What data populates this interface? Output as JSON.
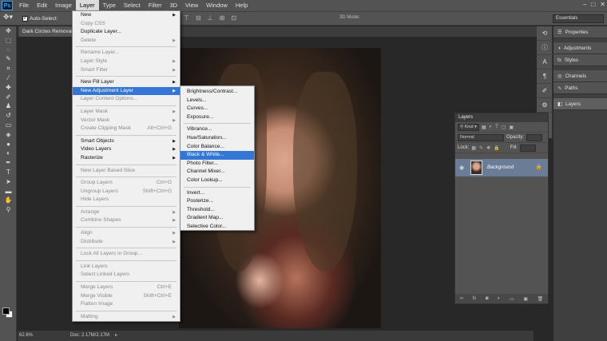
{
  "menubar": {
    "logo": "Ps",
    "items": [
      "File",
      "Edit",
      "Image",
      "Layer",
      "Type",
      "Select",
      "Filter",
      "3D",
      "View",
      "Window",
      "Help"
    ],
    "window_controls": [
      "–",
      "□",
      "✕"
    ]
  },
  "options_bar": {
    "auto_select_label": "Auto-Select:",
    "mode_3d_label": "3D Mode:",
    "workspace": "Essentials"
  },
  "document": {
    "tab_title": "Dark Circles Removal...",
    "zoom": "62.6%",
    "doc_size": "Doc: 2.17M/2.17M"
  },
  "layer_menu": {
    "items": [
      {
        "label": "New",
        "arrow": true,
        "disabled": false
      },
      {
        "label": "Copy CSS",
        "disabled": true
      },
      {
        "label": "Duplicate Layer...",
        "disabled": false
      },
      {
        "label": "Delete",
        "arrow": true,
        "disabled": true
      },
      {
        "sep": true
      },
      {
        "label": "Rename Layer...",
        "disabled": true
      },
      {
        "label": "Layer Style",
        "arrow": true,
        "disabled": true
      },
      {
        "label": "Smart Filter",
        "arrow": true,
        "disabled": true
      },
      {
        "sep": true
      },
      {
        "label": "New Fill Layer",
        "arrow": true,
        "disabled": false
      },
      {
        "label": "New Adjustment Layer",
        "arrow": true,
        "disabled": false,
        "highlight": true
      },
      {
        "label": "Layer Content Options...",
        "disabled": true
      },
      {
        "sep": true
      },
      {
        "label": "Layer Mask",
        "arrow": true,
        "disabled": true
      },
      {
        "label": "Vector Mask",
        "arrow": true,
        "disabled": true
      },
      {
        "label": "Create Clipping Mask",
        "shortcut": "Alt+Ctrl+G",
        "disabled": true
      },
      {
        "sep": true
      },
      {
        "label": "Smart Objects",
        "arrow": true,
        "disabled": false
      },
      {
        "label": "Video Layers",
        "arrow": true,
        "disabled": false
      },
      {
        "label": "Rasterize",
        "arrow": true,
        "disabled": false
      },
      {
        "sep": true
      },
      {
        "label": "New Layer Based Slice",
        "disabled": true
      },
      {
        "sep": true
      },
      {
        "label": "Group Layers",
        "shortcut": "Ctrl+G",
        "disabled": true
      },
      {
        "label": "Ungroup Layers",
        "shortcut": "Shift+Ctrl+G",
        "disabled": true
      },
      {
        "label": "Hide Layers",
        "disabled": true
      },
      {
        "sep": true
      },
      {
        "label": "Arrange",
        "arrow": true,
        "disabled": true
      },
      {
        "label": "Combine Shapes",
        "arrow": true,
        "disabled": true
      },
      {
        "sep": true
      },
      {
        "label": "Align",
        "arrow": true,
        "disabled": true
      },
      {
        "label": "Distribute",
        "arrow": true,
        "disabled": true
      },
      {
        "sep": true
      },
      {
        "label": "Lock All Layers in Group...",
        "disabled": true
      },
      {
        "sep": true
      },
      {
        "label": "Link Layers",
        "disabled": true
      },
      {
        "label": "Select Linked Layers",
        "disabled": true
      },
      {
        "sep": true
      },
      {
        "label": "Merge Layers",
        "shortcut": "Ctrl+E",
        "disabled": true
      },
      {
        "label": "Merge Visible",
        "shortcut": "Shift+Ctrl+E",
        "disabled": true
      },
      {
        "label": "Flatten Image",
        "disabled": true
      },
      {
        "sep": true
      },
      {
        "label": "Matting",
        "arrow": true,
        "disabled": true
      }
    ]
  },
  "adjustment_menu": {
    "items": [
      {
        "label": "Brightness/Contrast..."
      },
      {
        "label": "Levels..."
      },
      {
        "label": "Curves..."
      },
      {
        "label": "Exposure..."
      },
      {
        "sep": true
      },
      {
        "label": "Vibrance..."
      },
      {
        "label": "Hue/Saturation..."
      },
      {
        "label": "Color Balance..."
      },
      {
        "label": "Black & White...",
        "highlight": true
      },
      {
        "label": "Photo Filter..."
      },
      {
        "label": "Channel Mixer..."
      },
      {
        "label": "Color Lookup..."
      },
      {
        "sep": true
      },
      {
        "label": "Invert..."
      },
      {
        "label": "Posterize..."
      },
      {
        "label": "Threshold..."
      },
      {
        "label": "Gradient Map..."
      },
      {
        "label": "Selective Color..."
      }
    ]
  },
  "layers_panel": {
    "title": "Layers",
    "kind_label": "Kind",
    "blend_mode": "Normal",
    "opacity_label": "Opacity:",
    "lock_label": "Lock:",
    "fill_label": "Fill:",
    "layer_name": "Background"
  },
  "right_dock": {
    "items": [
      "Properties",
      "Adjustments",
      "Styles",
      "Channels",
      "Paths",
      "Layers"
    ]
  }
}
